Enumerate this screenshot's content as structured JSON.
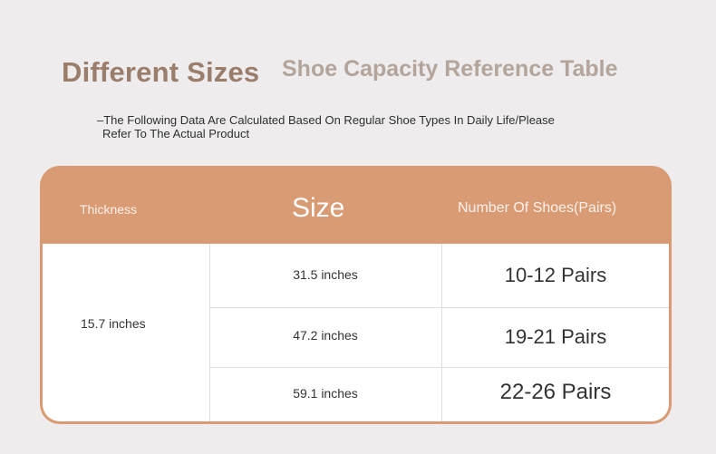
{
  "heading": {
    "main": "Different Sizes",
    "sub": "Shoe Capacity Reference Table"
  },
  "note": {
    "dash": "–",
    "line1": "The Following Data Are Calculated Based On Regular Shoe Types In Daily Life/Please",
    "line2": "Refer To The Actual Product"
  },
  "table": {
    "header": {
      "thickness": "Thickness",
      "size": "Size",
      "number": "Number Of Shoes(Pairs)"
    },
    "thickness_value": "15.7 inches",
    "rows": [
      {
        "size": "31.5 inches",
        "pairs": "10-12 Pairs"
      },
      {
        "size": "47.2 inches",
        "pairs": "19-21 Pairs"
      },
      {
        "size": "59.1 inches",
        "pairs": "22-26 Pairs"
      }
    ]
  },
  "colors": {
    "header_bg": "#d99b74",
    "title_main": "#9b7d6c",
    "title_sub": "#b4a59c",
    "page_bg": "#eeecec"
  }
}
